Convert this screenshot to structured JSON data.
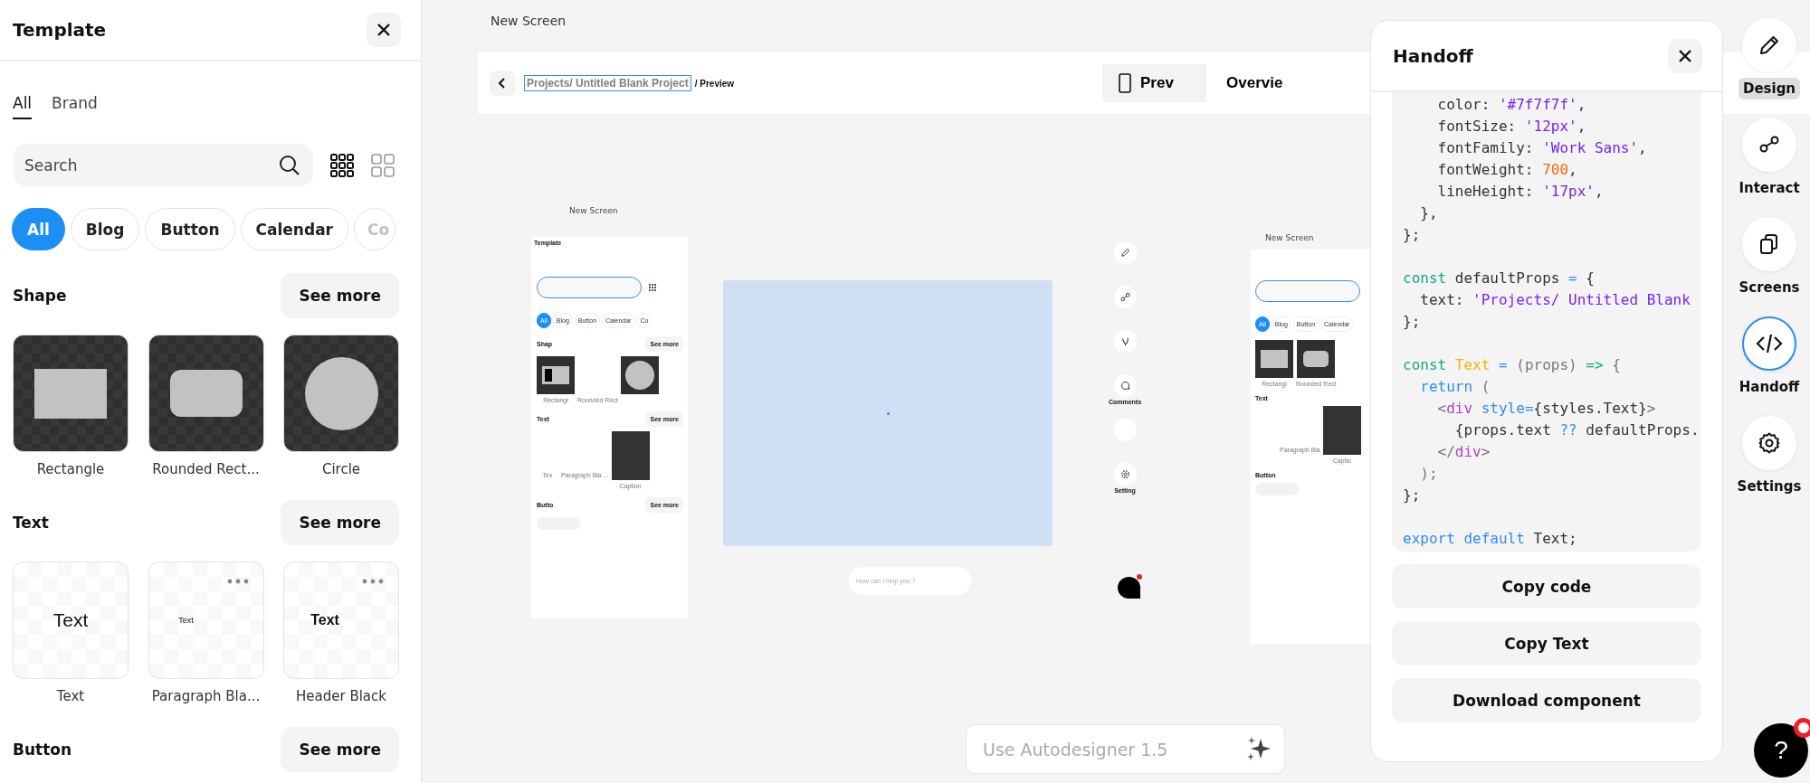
{
  "left_panel": {
    "title": "Template",
    "tabs": [
      {
        "label": "All",
        "selected": true
      },
      {
        "label": "Brand",
        "selected": false
      }
    ],
    "search": {
      "placeholder": "Search"
    },
    "view_modes": [
      {
        "kind": "small_grid",
        "selected": true
      },
      {
        "kind": "large_grid",
        "selected": false
      }
    ],
    "chips": [
      {
        "label": "All",
        "selected": true
      },
      {
        "label": "Blog",
        "selected": false
      },
      {
        "label": "Button",
        "selected": false
      },
      {
        "label": "Calendar",
        "selected": false
      },
      {
        "label": "Co",
        "selected": false
      }
    ],
    "sections": [
      {
        "title": "Shape",
        "button": "See more",
        "items": [
          {
            "label": "Rectangle",
            "kind": "rect"
          },
          {
            "label": "Rounded Rect...",
            "kind": "rounded"
          },
          {
            "label": "Circle",
            "kind": "circle"
          }
        ]
      },
      {
        "title": "Text",
        "button": "See more",
        "items": [
          {
            "label": "Text",
            "kind": "text_regular",
            "sample": "Text",
            "menu": false
          },
          {
            "label": "Paragraph Bla...",
            "kind": "text_small",
            "sample": "Text",
            "menu": true
          },
          {
            "label": "Header Black",
            "kind": "text_bold",
            "sample": "Text",
            "menu": true
          }
        ]
      },
      {
        "title": "Button",
        "button": "See more"
      }
    ]
  },
  "canvas": {
    "frame_label": "New Screen",
    "preview_header": {
      "breadcrumb": "Projects/ Untitled Blank Project",
      "breadcrumb_selected": true,
      "suffix": "/ Preview",
      "tabs": [
        {
          "label": "Prev",
          "kind": "device",
          "selected": true
        },
        {
          "label": "Overvie",
          "kind": "plain",
          "selected": false
        }
      ]
    },
    "mini_screens": [
      {
        "label": "New Screen",
        "title": "Template",
        "grid_icon": true,
        "chips": [
          {
            "label": "All",
            "selected": true
          },
          {
            "label": "Blog",
            "selected": false
          },
          {
            "label": "Button",
            "selected": false
          },
          {
            "label": "Calendar",
            "selected": false
          },
          {
            "label": "Co",
            "selected": false
          }
        ],
        "sections": [
          {
            "title": "Shap",
            "button": "See more",
            "items": [
              {
                "label": "Rectangl",
                "kind": "rect_selected"
              },
              {
                "label": "Rounded Rect",
                "kind": "blank"
              },
              {
                "kind": "circle"
              }
            ]
          },
          {
            "title": "Text",
            "button": "See more",
            "items": [
              {
                "label": "Tex",
                "kind": "blank"
              },
              {
                "label": "Paragraph Bla ...",
                "kind": "blank"
              },
              {
                "label": "Caption",
                "kind": "dark"
              }
            ]
          },
          {
            "title": "Butto",
            "button": "See more",
            "items": [
              {
                "kind": "pill"
              }
            ]
          }
        ]
      },
      {
        "label": "New Screen",
        "grid_icon": false,
        "chips": [
          {
            "label": "All",
            "selected": true
          },
          {
            "label": "Blog",
            "selected": false
          },
          {
            "label": "Button",
            "selected": false
          },
          {
            "label": "Calendar",
            "selected": false
          }
        ],
        "sections": [
          {
            "items": [
              {
                "label": "Rectangl",
                "kind": "rect"
              },
              {
                "label": "Rounded Rect",
                "kind": "rounded"
              }
            ]
          },
          {
            "title": "Text",
            "items": [
              {
                "kind": "blank"
              },
              {
                "label": "Paragraph Bla",
                "kind": "blank"
              },
              {
                "label": "Captio",
                "kind": "dark"
              }
            ]
          },
          {
            "title": "Button",
            "items": [
              {
                "kind": "pill"
              }
            ]
          }
        ]
      }
    ],
    "mini_rail": [
      {
        "kind": "pencil"
      },
      {
        "kind": "link"
      },
      {
        "kind": "glyph"
      },
      {
        "label": "Comments",
        "kind": "comment"
      },
      {
        "kind": "blank"
      },
      {
        "label": "Setting",
        "kind": "gear"
      }
    ],
    "mini_chat": {
      "placeholder": "How can I help you ?"
    },
    "autodesigner": {
      "placeholder": "Use Autodesigner 1.5"
    }
  },
  "handoff": {
    "title": "Handoff",
    "code_lines": [
      {
        "kind": "code",
        "tokens": [
          {
            "t": "    color: ",
            "kind": "plain"
          },
          {
            "t": "'#7f7f7f'",
            "kind": "string"
          },
          {
            "t": ",",
            "kind": "plain"
          }
        ]
      },
      {
        "kind": "code",
        "tokens": [
          {
            "t": "    fontSize: ",
            "kind": "plain"
          },
          {
            "t": "'12px'",
            "kind": "string"
          },
          {
            "t": ",",
            "kind": "plain"
          }
        ]
      },
      {
        "kind": "code",
        "tokens": [
          {
            "t": "    fontFamily: ",
            "kind": "plain"
          },
          {
            "t": "'Work Sans'",
            "kind": "string"
          },
          {
            "t": ",",
            "kind": "plain"
          }
        ]
      },
      {
        "kind": "code",
        "tokens": [
          {
            "t": "    fontWeight: ",
            "kind": "plain"
          },
          {
            "t": "700",
            "kind": "number"
          },
          {
            "t": ",",
            "kind": "plain"
          }
        ]
      },
      {
        "kind": "code",
        "tokens": [
          {
            "t": "    lineHeight: ",
            "kind": "plain"
          },
          {
            "t": "'17px'",
            "kind": "string"
          },
          {
            "t": ",",
            "kind": "plain"
          }
        ]
      },
      {
        "kind": "code",
        "tokens": [
          {
            "t": "  },",
            "kind": "plain"
          }
        ]
      },
      {
        "kind": "code",
        "tokens": [
          {
            "t": "};",
            "kind": "plain"
          }
        ]
      },
      {
        "kind": "blank"
      },
      {
        "kind": "code",
        "tokens": [
          {
            "t": "const",
            "kind": "keyword"
          },
          {
            "t": " defaultProps ",
            "kind": "plain"
          },
          {
            "t": "=",
            "kind": "operator"
          },
          {
            "t": " {",
            "kind": "plain"
          }
        ]
      },
      {
        "kind": "code",
        "tokens": [
          {
            "t": "  text: ",
            "kind": "plain"
          },
          {
            "t": "'Projects/ Untitled Blank",
            "kind": "string"
          }
        ]
      },
      {
        "kind": "code",
        "tokens": [
          {
            "t": "};",
            "kind": "plain"
          }
        ]
      },
      {
        "kind": "blank"
      },
      {
        "kind": "code",
        "tokens": [
          {
            "t": "const",
            "kind": "keyword"
          },
          {
            "t": " Text",
            "kind": "type"
          },
          {
            "t": " =",
            "kind": "operator"
          },
          {
            "t": " (props) ",
            "kind": "punct"
          },
          {
            "t": "=>",
            "kind": "keyword"
          },
          {
            "t": " {",
            "kind": "punct"
          }
        ]
      },
      {
        "kind": "code",
        "tokens": [
          {
            "t": "  return",
            "kind": "operator"
          },
          {
            "t": " (",
            "kind": "punct"
          }
        ]
      },
      {
        "kind": "code",
        "tokens": [
          {
            "t": "    <",
            "kind": "punct"
          },
          {
            "t": "div",
            "kind": "tag"
          },
          {
            "t": " style=",
            "kind": "operator"
          },
          {
            "t": "{styles.Text}",
            "kind": "plain"
          },
          {
            "t": ">",
            "kind": "punct"
          }
        ]
      },
      {
        "kind": "code",
        "tokens": [
          {
            "t": "      {props.text ",
            "kind": "plain"
          },
          {
            "t": "??",
            "kind": "operator"
          },
          {
            "t": " defaultProps.",
            "kind": "plain"
          }
        ]
      },
      {
        "kind": "code",
        "tokens": [
          {
            "t": "    </",
            "kind": "punct"
          },
          {
            "t": "div",
            "kind": "tag"
          },
          {
            "t": ">",
            "kind": "punct"
          }
        ]
      },
      {
        "kind": "code",
        "tokens": [
          {
            "t": "  );",
            "kind": "punct"
          }
        ]
      },
      {
        "kind": "code",
        "tokens": [
          {
            "t": "};",
            "kind": "plain"
          }
        ]
      },
      {
        "kind": "blank"
      },
      {
        "kind": "code",
        "tokens": [
          {
            "t": "export default",
            "kind": "operator"
          },
          {
            "t": " Text;",
            "kind": "plain"
          }
        ]
      }
    ],
    "buttons": [
      "Copy code",
      "Copy Text",
      "Download component"
    ]
  },
  "right_rail": [
    {
      "label": "Design",
      "kind": "pencil",
      "selected": false,
      "hovered": true
    },
    {
      "label": "Interact",
      "kind": "link",
      "selected": false,
      "hovered": false
    },
    {
      "label": "Screens",
      "kind": "screens",
      "selected": false,
      "hovered": false
    },
    {
      "label": "Handoff",
      "kind": "code",
      "selected": true,
      "hovered": false
    },
    {
      "label": "Settings",
      "kind": "gear",
      "selected": false,
      "hovered": false
    }
  ],
  "help": {
    "label": "?",
    "notification": true
  }
}
